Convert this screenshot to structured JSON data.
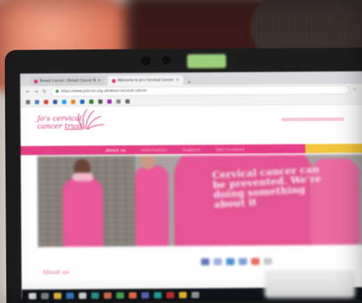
{
  "browser": {
    "tabs": [
      {
        "label": "Breast Cancer | Breast Cancer N",
        "active": false
      },
      {
        "label": "Welcome to Jo's Cervical Cancer",
        "active": true
      }
    ],
    "new_tab_symbol": "+",
    "url": "https://www.jostrust.org.uk/about-cervical-cancer",
    "nav_icons": [
      "back-arrow-icon",
      "forward-arrow-icon",
      "reload-icon"
    ]
  },
  "site": {
    "logo_line1": "Jo's cervical",
    "logo_line2a": "cancer",
    "logo_line2b": "trust",
    "nav": [
      "About us",
      "Information",
      "Support",
      "Get involved"
    ],
    "hero_text": "Cervical cancer can be prevented. We're doing something about it",
    "about_heading": "About us"
  },
  "colors": {
    "brand_pink": "#e43f87",
    "logo_pink": "#d22f72",
    "accent_yellow": "#f2c63c",
    "shirt_pink": "#e9589a"
  }
}
